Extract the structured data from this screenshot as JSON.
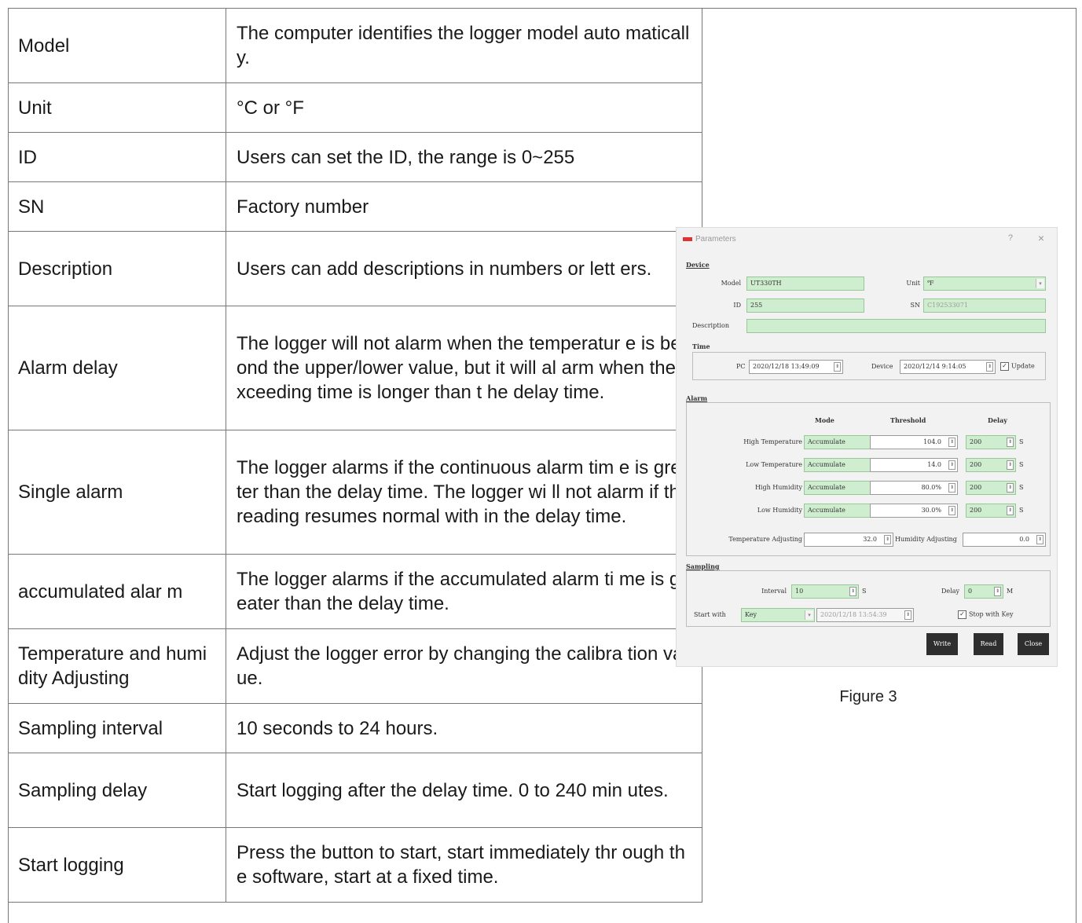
{
  "table": {
    "rows": [
      {
        "key": "Model",
        "value": "The computer identifies the logger model auto matically."
      },
      {
        "key": "Unit",
        "value": "°C or °F"
      },
      {
        "key": "ID",
        "value": "Users can set the ID, the range is 0~255"
      },
      {
        "key": "SN",
        "value": "Factory number"
      },
      {
        "key": "Description",
        "value": "Users can add descriptions in numbers or lett ers."
      },
      {
        "key": "Alarm delay",
        "value": "The logger will not alarm when the temperatur e is beyond the upper/lower value, but it will al arm when the exceeding time is longer than t he delay time."
      },
      {
        "key": "Single alarm",
        "value": "The logger alarms if the continuous alarm tim e is greater than the delay time. The logger wi ll not alarm if the reading resumes normal with in the delay time."
      },
      {
        "key": "accumulated alar m",
        "value": "The logger alarms if the accumulated alarm ti me is greater than the delay time."
      },
      {
        "key": "Temperature and humidity Adjusting",
        "value": "Adjust the logger error by changing the calibra tion value."
      },
      {
        "key": "Sampling interval",
        "value": "10 seconds to 24 hours."
      },
      {
        "key": "Sampling delay",
        "value": "Start logging after the delay time. 0 to 240 min utes."
      },
      {
        "key": "Start logging",
        "value": "Press the button to start, start immediately thr ough the software, start at a fixed time."
      }
    ]
  },
  "figure": {
    "caption": "Figure 3",
    "window_title": "Parameters",
    "help_glyph": "?",
    "close_glyph": "×",
    "device": {
      "section": "Device",
      "model_label": "Model",
      "model_value": "UT330TH",
      "unit_label": "Unit",
      "unit_value": "℉",
      "id_label": "ID",
      "id_value": "255",
      "sn_label": "SN",
      "sn_value": "C192533071",
      "description_label": "Description",
      "description_value": ""
    },
    "time": {
      "section": "Time",
      "pc_label": "PC",
      "pc_value": "2020/12/18 13:49:09",
      "device_label": "Device",
      "device_value": "2020/12/14 9:14:05",
      "update_label": "Update"
    },
    "alarm": {
      "section": "Alarm",
      "col_mode": "Mode",
      "col_threshold": "Threshold",
      "col_delay": "Delay",
      "rows": [
        {
          "label": "High Temperature",
          "mode": "Accumulate",
          "threshold": "104.0",
          "delay": "200",
          "unit": "S"
        },
        {
          "label": "Low Temperature",
          "mode": "Accumulate",
          "threshold": "14.0",
          "delay": "200",
          "unit": "S"
        },
        {
          "label": "High Humidity",
          "mode": "Accumulate",
          "threshold": "80.0%",
          "delay": "200",
          "unit": "S"
        },
        {
          "label": "Low Humidity",
          "mode": "Accumulate",
          "threshold": "30.0%",
          "delay": "200",
          "unit": "S"
        }
      ],
      "temp_adjust_label": "Temperature Adjusting",
      "temp_adjust_value": "32.0",
      "hum_adjust_label": "Humidity Adjusting",
      "hum_adjust_value": "0.0"
    },
    "sampling": {
      "section": "Sampling",
      "interval_label": "Interval",
      "interval_value": "10",
      "interval_unit": "S",
      "delay_label": "Delay",
      "delay_value": "0",
      "delay_unit": "M",
      "start_label": "Start with",
      "start_value": "Key",
      "start_time": "2020/12/18 13:54:39",
      "stop_label": "Stop with Key"
    },
    "buttons": {
      "write": "Write",
      "read": "Read",
      "close": "Close"
    }
  }
}
